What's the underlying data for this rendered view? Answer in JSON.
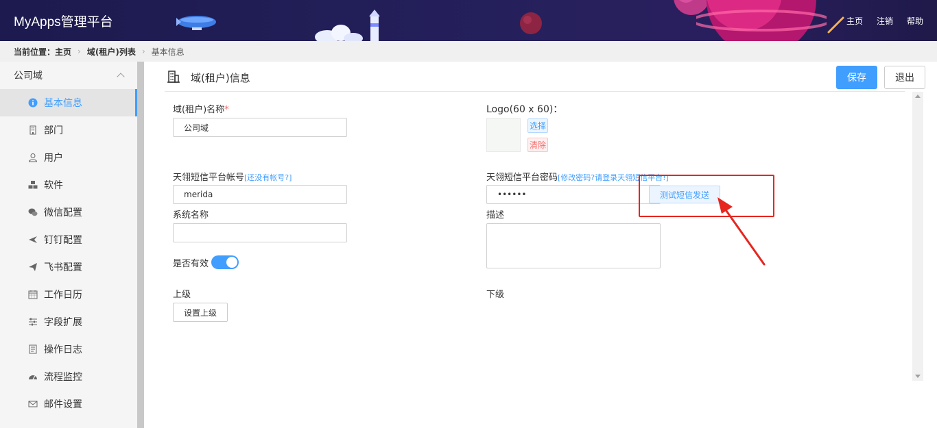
{
  "header": {
    "app_title": "MyApps管理平台",
    "nav": [
      "主页",
      "注销",
      "帮助"
    ]
  },
  "breadcrumb": {
    "label": "当前位置：",
    "items": [
      "主页",
      "域(租户)列表",
      "基本信息"
    ]
  },
  "sidebar": {
    "group_title": "公司域",
    "items": [
      {
        "label": "基本信息",
        "icon": "info-icon",
        "active": true
      },
      {
        "label": "部门",
        "icon": "building-icon"
      },
      {
        "label": "用户",
        "icon": "user-icon"
      },
      {
        "label": "软件",
        "icon": "cubes-icon"
      },
      {
        "label": "微信配置",
        "icon": "wechat-icon"
      },
      {
        "label": "钉钉配置",
        "icon": "plane-icon"
      },
      {
        "label": "飞书配置",
        "icon": "paper-plane-icon"
      },
      {
        "label": "工作日历",
        "icon": "calendar-icon"
      },
      {
        "label": "字段扩展",
        "icon": "sliders-icon"
      },
      {
        "label": "操作日志",
        "icon": "log-icon"
      },
      {
        "label": "流程监控",
        "icon": "dashboard-icon"
      },
      {
        "label": "邮件设置",
        "icon": "mail-icon"
      }
    ]
  },
  "panel": {
    "title": "域(租户)信息",
    "save_label": "保存",
    "exit_label": "退出"
  },
  "form": {
    "name_label": "域(租户)名称",
    "name_required": "*",
    "name_value": "公司域",
    "logo_label": "Logo(60 x 60)：",
    "logo_select": "选择",
    "logo_clear": "清除",
    "sms_account_label": "天翎短信平台帐号",
    "sms_account_link": "[还没有帐号?]",
    "sms_account_value": "merida",
    "sms_password_label": "天翎短信平台密码",
    "sms_password_link": "[修改密码?请登录天翎短信平台!]",
    "sms_password_value": "••••••",
    "sms_test_button": "测试短信发送",
    "system_name_label": "系统名称",
    "system_name_value": "",
    "description_label": "描述",
    "enabled_label": "是否有效",
    "enabled": true,
    "parent_label": "上级",
    "parent_button": "设置上级",
    "child_label": "下级"
  },
  "colors": {
    "accent": "#409eff",
    "annotation": "#e6261f",
    "header_bg": "#1c1a4e"
  }
}
